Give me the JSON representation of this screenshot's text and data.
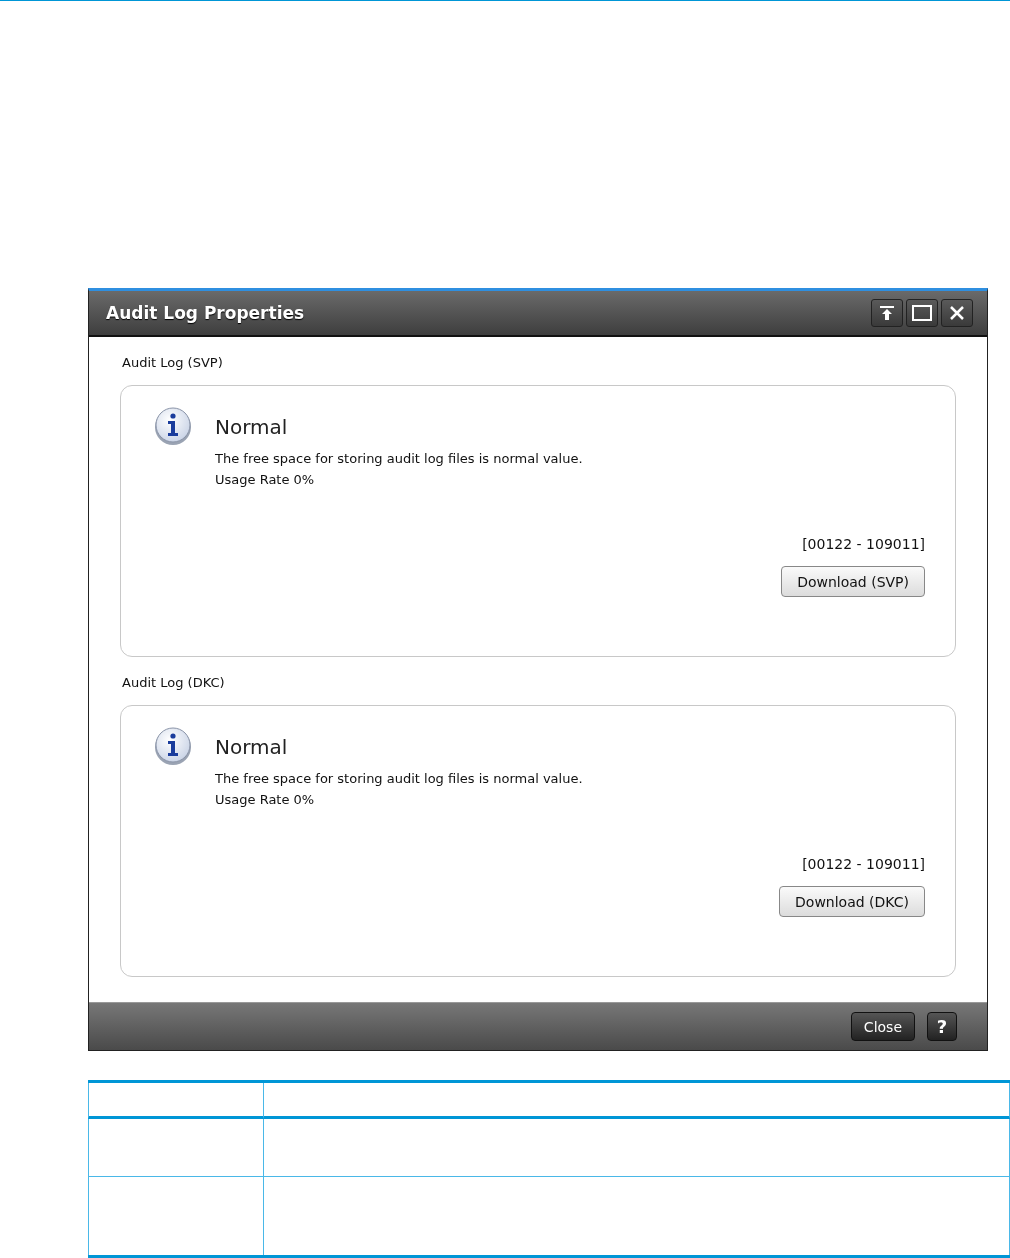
{
  "window": {
    "title": "Audit Log Properties"
  },
  "sections": [
    {
      "label": "Audit Log (SVP)",
      "status": "Normal",
      "message": "The free space for storing audit log files is normal value.",
      "usage": "Usage Rate 0%",
      "code": "[00122 - 109011]",
      "button": "Download (SVP)"
    },
    {
      "label": "Audit Log (DKC)",
      "status": "Normal",
      "message": "The free space for storing audit log files is normal value.",
      "usage": "Usage Rate 0%",
      "code": "[00122 - 109011]",
      "button": "Download (DKC)"
    }
  ],
  "footer": {
    "close": "Close",
    "help": "?"
  }
}
